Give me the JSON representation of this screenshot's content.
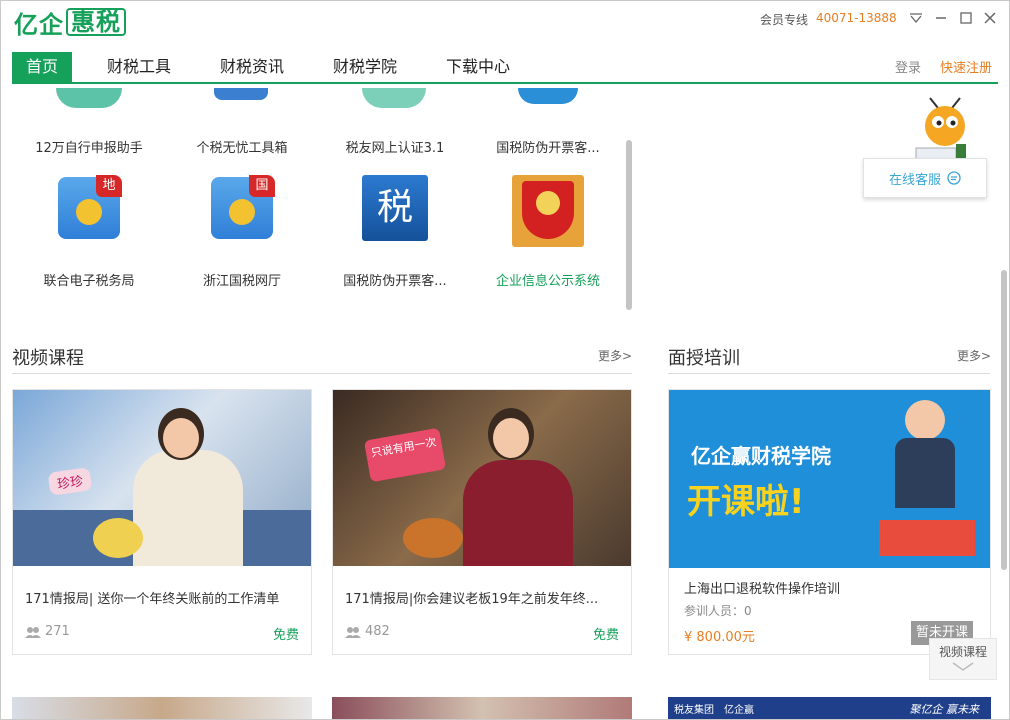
{
  "app": {
    "logo": "亿企惠税",
    "logo_part1": "亿企",
    "logo_part2": "惠税"
  },
  "header": {
    "hotline_label": "会员专线",
    "hotline_number": "40071-13888"
  },
  "nav": {
    "tabs": [
      {
        "label": "首页",
        "active": true
      },
      {
        "label": "财税工具",
        "active": false
      },
      {
        "label": "财税资讯",
        "active": false
      },
      {
        "label": "财税学院",
        "active": false
      },
      {
        "label": "下载中心",
        "active": false
      }
    ],
    "login": "登录",
    "register": "快速注册"
  },
  "tools": {
    "row1": [
      "12万自行申报助手",
      "个税无忧工具箱",
      "税友网上认证3.1",
      "国税防伪开票客..."
    ],
    "row2": [
      {
        "label": "联合电子税务局",
        "badge": "地"
      },
      {
        "label": "浙江国税网厅",
        "badge": "国"
      },
      {
        "label": "国税防伪开票客...",
        "badge": "税"
      },
      {
        "label": "企业信息公示系统",
        "badge": ""
      }
    ]
  },
  "service": {
    "label": "在线客服"
  },
  "video_section": {
    "title": "视频课程",
    "more": "更多>",
    "courses": [
      {
        "title": "171情报局| 送你一个年终关账前的工作清单",
        "views": "271",
        "price": "免费",
        "sticker": "珍珍"
      },
      {
        "title": "171情报局|你会建议老板19年之前发年终...",
        "views": "482",
        "price": "免费",
        "sticker": "只说有用一次"
      }
    ]
  },
  "training_section": {
    "title": "面授培训",
    "more": "更多>",
    "banner_line1": "亿企赢财税学院",
    "banner_line2": "开课啦!",
    "course_title": "上海出口退税软件操作培训",
    "participants_label": "参训人员：0",
    "price": "¥ 800.00元",
    "status": "暂未开课"
  },
  "floating": {
    "video_label": "视频课程"
  },
  "bottom_strip": {
    "label1": "税友集团",
    "label2": "亿企赢",
    "slogan": "聚亿企 赢未来"
  },
  "colors": {
    "brand_green": "#16a15a",
    "orange": "#e67e22",
    "service_blue": "#3aa6d6"
  }
}
